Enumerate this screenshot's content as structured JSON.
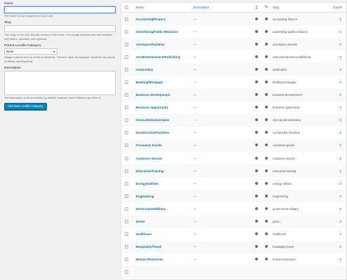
{
  "form": {
    "name_label": "Name",
    "name_desc": "The name is how it appears on your site.",
    "slug_label": "Slug",
    "slug_desc": "The “slug” is the URL-friendly version of the name. It is usually all lowercase and contains only letters, numbers, and hyphens.",
    "parent_label": "Parent Locallio Category",
    "parent_value": "None",
    "parent_desc": "Assign a parent term to create a hierarchy. The term Jazz, for example, would be the parent of Bebop and Big Band.",
    "description_label": "Description",
    "description_desc": "The description is not prominent by default; however, some themes may show it.",
    "submit_label": "Add New Locallio Category"
  },
  "table": {
    "columns": {
      "name": "Name",
      "description": "Description",
      "icon1": "document-icon",
      "icon2": "pencil-icon",
      "slug": "Slug",
      "count": "Count"
    },
    "rows": [
      {
        "name": "Accounting/Finance",
        "desc": "—",
        "slug": "accounting-finance",
        "count": "0"
      },
      {
        "name": "Advertising/Public Relations",
        "desc": "—",
        "slug": "advertising-public-relations",
        "count": "0"
      },
      {
        "name": "Aerospace/Aviation",
        "desc": "—",
        "slug": "aerospace-aviation",
        "count": "0"
      },
      {
        "name": "Arts/Entertainment/Publishing",
        "desc": "—",
        "slug": "arts-entertainment-publishing",
        "count": "0"
      },
      {
        "name": "Automotive",
        "desc": "—",
        "slug": "automotive",
        "count": "2"
      },
      {
        "name": "Banking/Mortgage",
        "desc": "—",
        "slug": "banking-mortgage",
        "count": "0"
      },
      {
        "name": "Business Development",
        "desc": "—",
        "slug": "business-development",
        "count": "0"
      },
      {
        "name": "Business Opportunity",
        "desc": "—",
        "slug": "business-opportunity",
        "count": "0"
      },
      {
        "name": "Clerical/Administrative",
        "desc": "—",
        "slug": "clerical-administrative",
        "count": "0"
      },
      {
        "name": "Construction/Facilities",
        "desc": "—",
        "slug": "construction-facilities",
        "count": "1"
      },
      {
        "name": "Consumer Goods",
        "desc": "—",
        "slug": "consumer-goods",
        "count": "0"
      },
      {
        "name": "Customer Service",
        "desc": "—",
        "slug": "customer-service",
        "count": "0"
      },
      {
        "name": "Education/Training",
        "desc": "—",
        "slug": "education-training",
        "count": "1"
      },
      {
        "name": "Energy/Utilities",
        "desc": "—",
        "slug": "energy-utilities",
        "count": "0"
      },
      {
        "name": "Engineering",
        "desc": "—",
        "slug": "engineering",
        "count": "0"
      },
      {
        "name": "Government/Military",
        "desc": "—",
        "slug": "government-military",
        "count": "0"
      },
      {
        "name": "Green",
        "desc": "—",
        "slug": "green",
        "count": "0"
      },
      {
        "name": "Healthcare",
        "desc": "—",
        "slug": "healthcare",
        "count": "2"
      },
      {
        "name": "Hospitality/Travel",
        "desc": "—",
        "slug": "hospitality-travel",
        "count": "0"
      },
      {
        "name": "Human Resources",
        "desc": "—",
        "slug": "human-resources",
        "count": "0"
      },
      {
        "name": "",
        "desc": "",
        "slug": "",
        "count": ""
      }
    ]
  },
  "colors": {
    "link": "#0073aa",
    "button": "#0085ba",
    "background": "#f1f1f1"
  }
}
